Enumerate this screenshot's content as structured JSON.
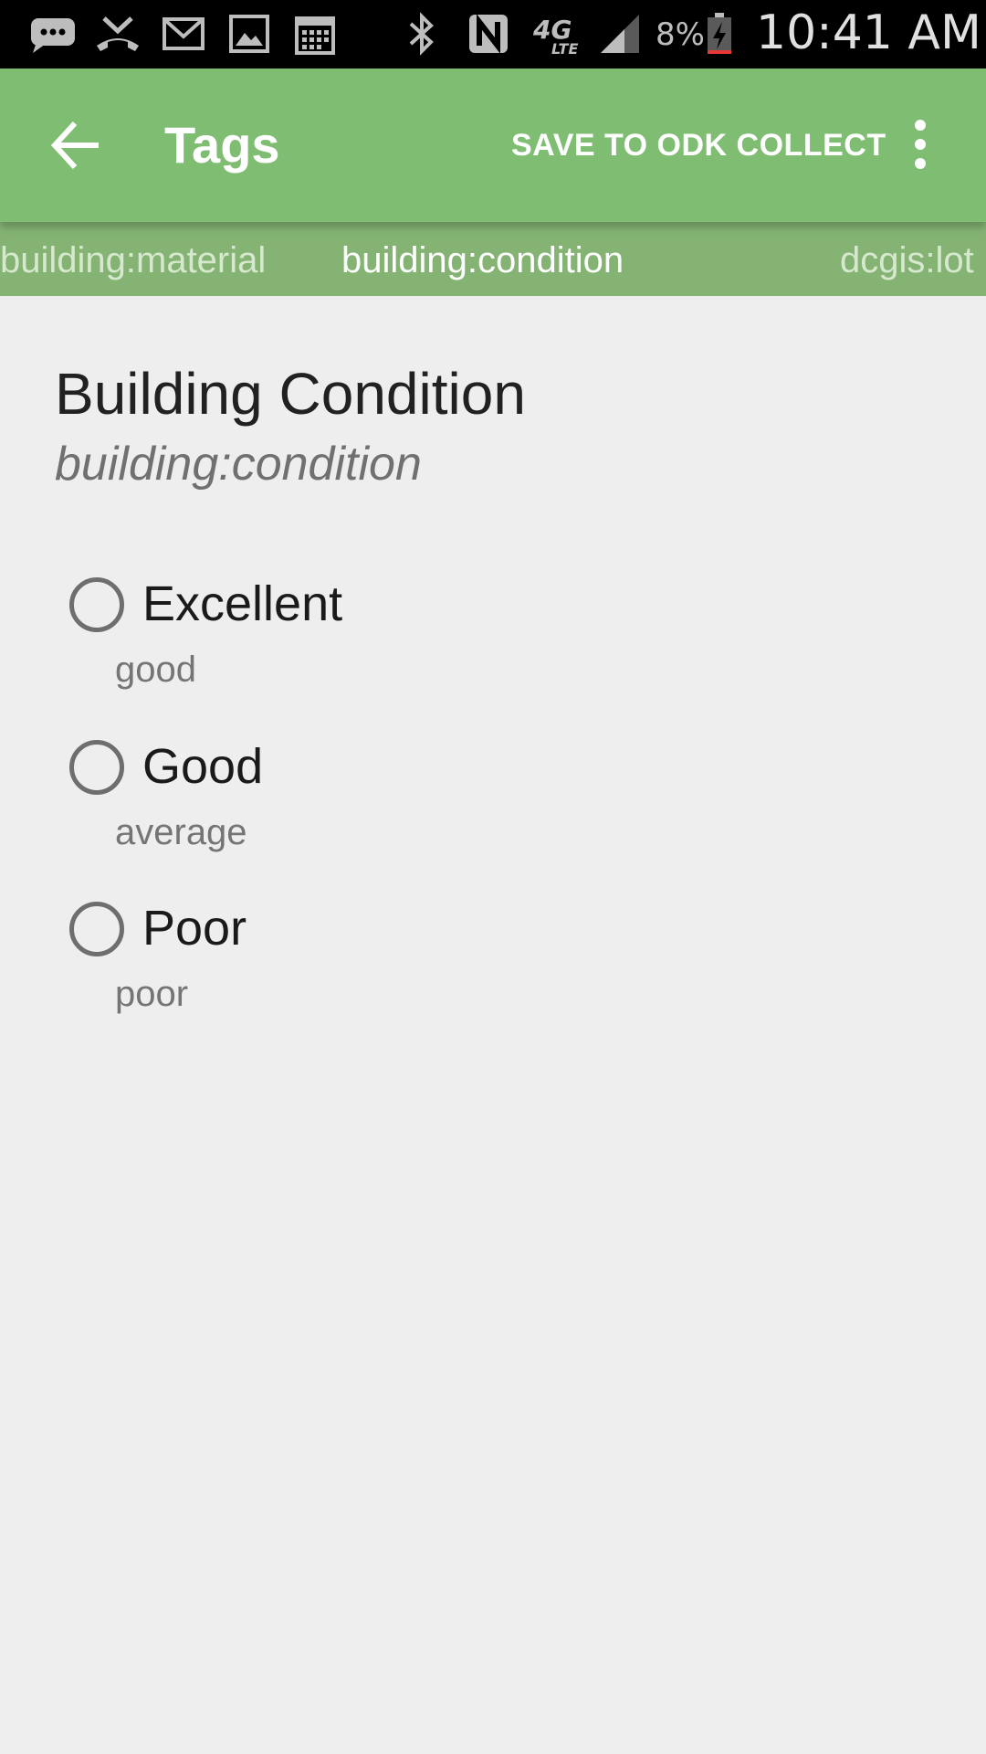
{
  "status_bar": {
    "icons": [
      "messages-icon",
      "missed-call-icon",
      "gmail-icon",
      "gallery-icon",
      "calendar-icon",
      "bluetooth-icon",
      "nfc-icon",
      "network-4g-lte-icon",
      "signal-icon",
      "battery-charging-icon"
    ],
    "battery": "8%",
    "time": "10:41 AM",
    "network_label": "4G",
    "network_sub": "LTE"
  },
  "app_bar": {
    "title": "Tags",
    "back_icon": "arrow-back-icon",
    "save_label": "SAVE TO ODK COLLECT",
    "overflow_icon": "more-vert-icon",
    "color": "#7fbe72"
  },
  "tabs": [
    {
      "label": "building:material",
      "active": false
    },
    {
      "label": "building:condition",
      "active": true
    },
    {
      "label": "dcgis:lot",
      "active": false
    }
  ],
  "question": {
    "title": "Building Condition",
    "key": "building:condition"
  },
  "options": [
    {
      "label": "Excellent",
      "value": "good",
      "selected": false
    },
    {
      "label": "Good",
      "value": "average",
      "selected": false
    },
    {
      "label": "Poor",
      "value": "poor",
      "selected": false
    }
  ]
}
